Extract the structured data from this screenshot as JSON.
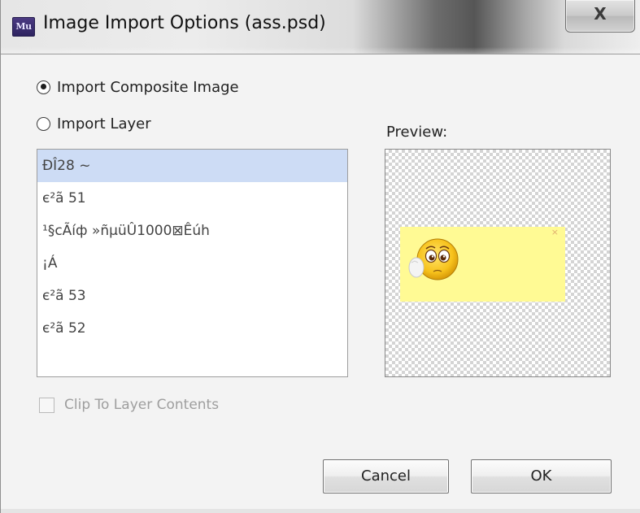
{
  "window": {
    "title": "Image Import Options (ass.psd)",
    "app_icon_text": "Mu",
    "close_glyph": "X"
  },
  "import_mode": {
    "composite_label": "Import Composite Image",
    "layer_label": "Import Layer",
    "selected": "composite"
  },
  "layers": {
    "items": [
      "ÐÎ28 ~",
      "є²ã 51",
      "¹§cÃíф »ñµüÛ1000⊠Êúh",
      "¡Á",
      "є²ã 53",
      "є²ã 52"
    ],
    "selected_index": 0
  },
  "preview": {
    "label": "Preview:",
    "card_close_glyph": "×"
  },
  "clip": {
    "label": "Clip To Layer Contents",
    "checked": false,
    "enabled": false
  },
  "buttons": {
    "cancel": "Cancel",
    "ok": "OK"
  },
  "colors": {
    "selection": "#cddcf5",
    "preview_card": "#fffa94"
  }
}
